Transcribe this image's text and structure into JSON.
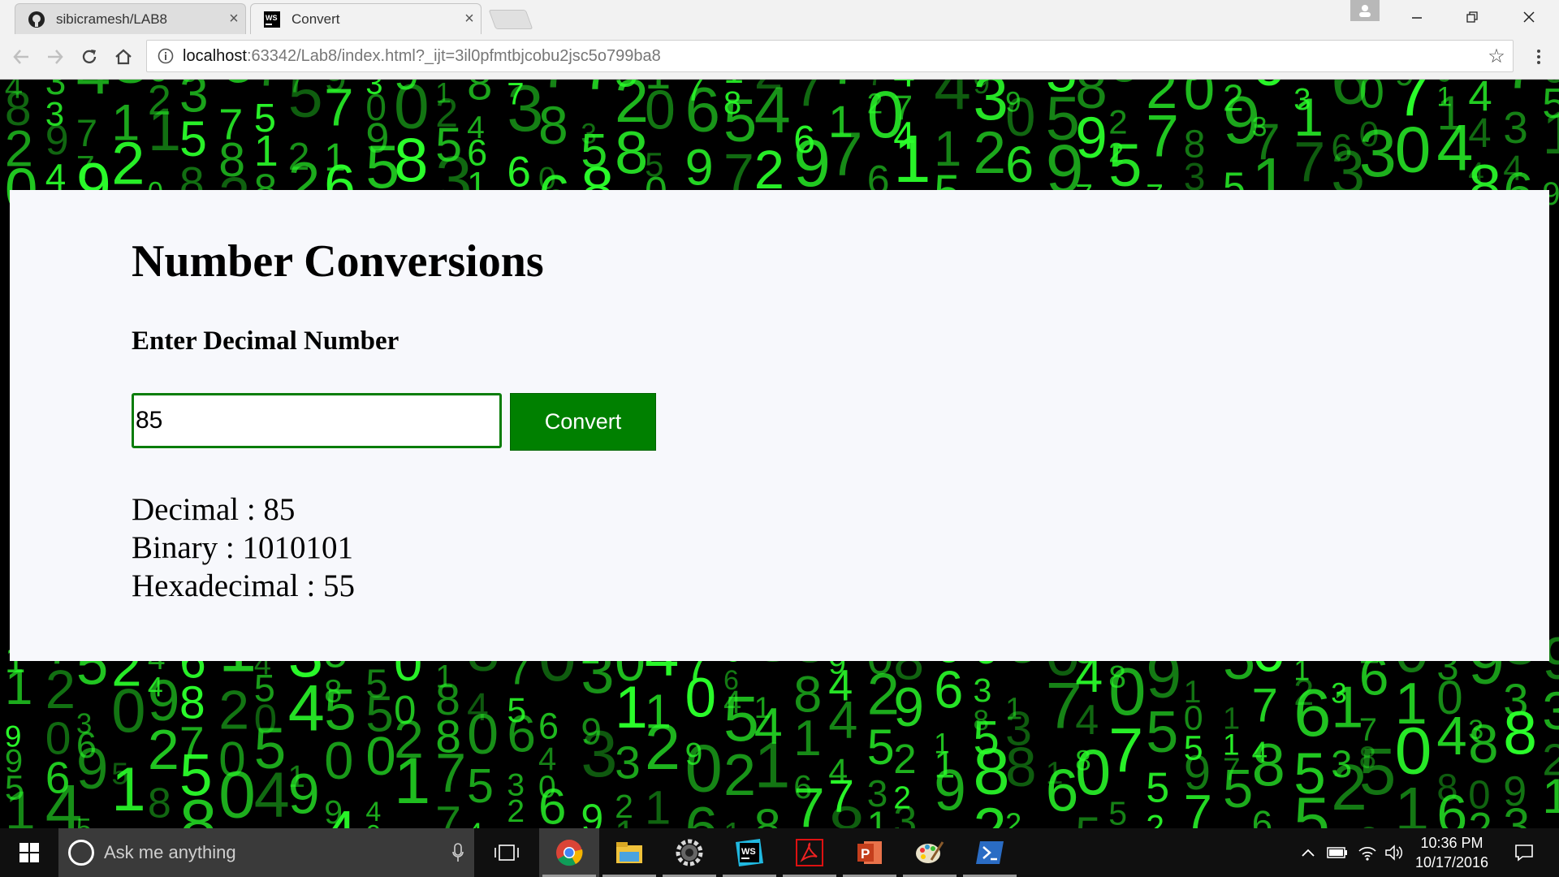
{
  "browser": {
    "tabs": [
      {
        "title": "sibicramesh/LAB8",
        "icon": "github-icon"
      },
      {
        "title": "Convert",
        "icon": "webstorm-icon"
      }
    ],
    "url_host": "localhost",
    "url_rest": ":63342/Lab8/index.html?_ijt=3il0pfmtbjcobu2jsc5o799ba8"
  },
  "page": {
    "heading": "Number Conversions",
    "input_label": "Enter Decimal Number",
    "input_value": "85",
    "button_label": "Convert",
    "results": {
      "decimal": "Decimal : 85",
      "binary": "Binary : 1010101",
      "hex": "Hexadecimal : 55"
    },
    "colors": {
      "button_bg": "#008000",
      "input_border": "#0a7d0a",
      "matrix_green": "#2bff2b"
    }
  },
  "taskbar": {
    "search_placeholder": "Ask me anything",
    "apps": [
      "chrome-icon",
      "file-explorer-icon",
      "settings-gear-icon",
      "webstorm-icon",
      "acrobat-icon",
      "powerpoint-icon",
      "paint-icon",
      "powershell-icon"
    ],
    "time": "10:36 PM",
    "date": "10/17/2016"
  }
}
